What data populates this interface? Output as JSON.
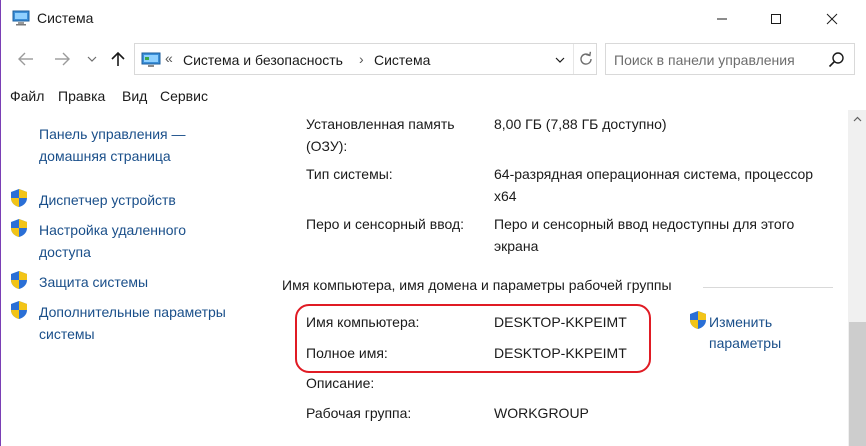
{
  "window": {
    "title": "Система"
  },
  "nav": {
    "breadcrumb_chevron": "«",
    "breadcrumb": [
      "Система и безопасность",
      "Система"
    ],
    "breadcrumb_sep": "›",
    "search_placeholder": "Поиск в панели управления"
  },
  "menu": [
    "Файл",
    "Правка",
    "Вид",
    "Сервис"
  ],
  "sidebar": {
    "home": [
      "Панель управления —",
      "домашняя страница"
    ],
    "items": [
      {
        "lines": [
          "Диспетчер устройств"
        ],
        "icon": "shield-icon"
      },
      {
        "lines": [
          "Настройка удаленного",
          "доступа"
        ],
        "icon": "shield-icon"
      },
      {
        "lines": [
          "Защита системы"
        ],
        "icon": "shield-icon"
      },
      {
        "lines": [
          "Дополнительные параметры",
          "системы"
        ],
        "icon": "shield-icon"
      }
    ]
  },
  "system": {
    "ram_label": [
      "Установленная память",
      "(ОЗУ):"
    ],
    "ram_value": "8,00 ГБ (7,88 ГБ доступно)",
    "type_label": "Тип системы:",
    "type_value": [
      "64-разрядная операционная система, процессор",
      "x64"
    ],
    "pen_label": "Перо и сенсорный ввод:",
    "pen_value": [
      "Перо и сенсорный ввод недоступны для этого",
      "экрана"
    ]
  },
  "computer": {
    "section_title": "Имя компьютера, имя домена и параметры рабочей группы",
    "name_label": "Имя компьютера:",
    "name_value": "DESKTOP-KKPEIMT",
    "full_label": "Полное имя:",
    "full_value": "DESKTOP-KKPEIMT",
    "desc_label": "Описание:",
    "group_label": "Рабочая группа:",
    "group_value": "WORKGROUP",
    "change_link": [
      "Изменить",
      "параметры"
    ]
  },
  "colors": {
    "link": "#1a4f8a",
    "highlight": "#e01b24",
    "window_border": "#7a3fb5"
  }
}
